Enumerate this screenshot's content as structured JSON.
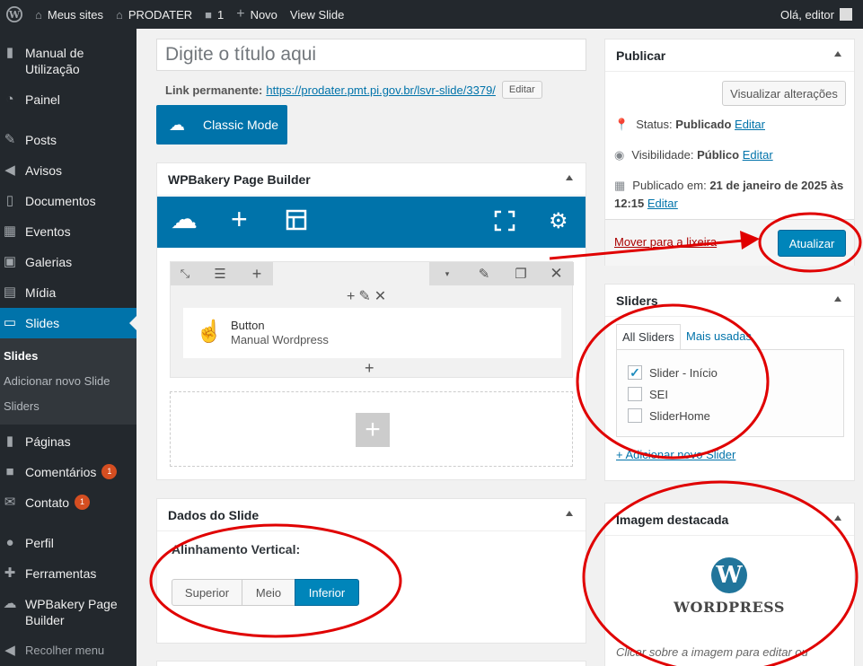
{
  "admin_bar": {
    "sites": "Meus sites",
    "site_name": "PRODATER",
    "comments_count": "1",
    "new_label": "Novo",
    "view_label": "View Slide",
    "greeting": "Olá, editor"
  },
  "sidebar": {
    "items": [
      {
        "label": "Manual de Utilização",
        "icon": "book-icon"
      },
      {
        "label": "Painel",
        "icon": "dashboard-icon"
      },
      {
        "label": "Posts",
        "icon": "pin-icon"
      },
      {
        "label": "Avisos",
        "icon": "megaphone-icon"
      },
      {
        "label": "Documentos",
        "icon": "document-icon"
      },
      {
        "label": "Eventos",
        "icon": "calendar-icon"
      },
      {
        "label": "Galerias",
        "icon": "gallery-icon"
      },
      {
        "label": "Mídia",
        "icon": "media-icon"
      },
      {
        "label": "Slides",
        "icon": "slides-icon"
      },
      {
        "label": "Páginas",
        "icon": "page-icon"
      },
      {
        "label": "Comentários",
        "icon": "comment-icon",
        "badge": "1"
      },
      {
        "label": "Contato",
        "icon": "mail-icon",
        "badge": "1"
      },
      {
        "label": "Perfil",
        "icon": "user-icon"
      },
      {
        "label": "Ferramentas",
        "icon": "wrench-icon"
      },
      {
        "label": "WPBakery Page Builder",
        "icon": "wpbakery-icon"
      }
    ],
    "submenu": [
      "Slides",
      "Adicionar novo Slide",
      "Sliders"
    ],
    "collapse": "Recolher menu"
  },
  "editor": {
    "title_placeholder": "Digite o título aqui",
    "permalink_label": "Link permanente:",
    "permalink_url": "https://prodater.pmt.pi.gov.br/lsvr-slide/3379/",
    "edit_button": "Editar",
    "classic_mode": "Classic Mode"
  },
  "wpbakery": {
    "title": "WPBakery Page Builder",
    "element_title": "Button",
    "element_subtitle": "Manual Wordpress"
  },
  "slide_data": {
    "title": "Dados do Slide",
    "alignment_label": "Alinhamento Vertical:",
    "options": [
      "Superior",
      "Meio",
      "Inferior"
    ],
    "selected": "Inferior"
  },
  "publish": {
    "title": "Publicar",
    "preview_button": "Visualizar alterações",
    "status_label": "Status:",
    "status_value": "Publicado",
    "visibility_label": "Visibilidade:",
    "visibility_value": "Público",
    "published_label": "Publicado em:",
    "published_value": "21 de janeiro de 2025 às",
    "published_time": "12:15",
    "edit_link": "Editar",
    "trash_link": "Mover para a lixeira",
    "update_button": "Atualizar"
  },
  "sliders": {
    "title": "Sliders",
    "tab_all": "All Sliders",
    "tab_popular": "Mais usadas",
    "items": [
      {
        "label": "Slider - Início",
        "checked": true
      },
      {
        "label": "SEI",
        "checked": false
      },
      {
        "label": "SliderHome",
        "checked": false
      }
    ],
    "add_new": "+ Adicionar novo Slider"
  },
  "featured_image": {
    "title": "Imagem destacada",
    "logo_text": "WORDPRESS",
    "hint": "Clicar sobre a imagem para editar ou"
  },
  "colors": {
    "admin_dark": "#23282d",
    "accent": "#0073aa",
    "annotation_red": "#e00000"
  }
}
